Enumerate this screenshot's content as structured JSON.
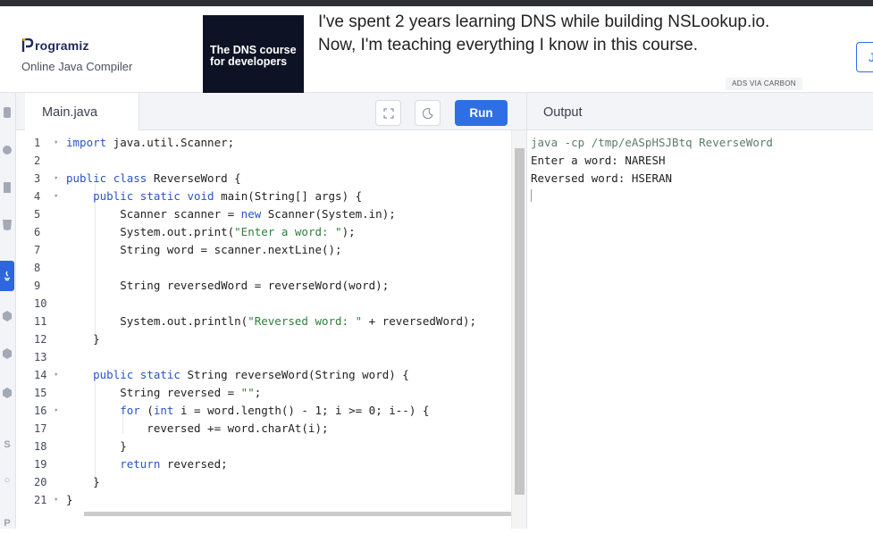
{
  "brand": {
    "name": "rogramiz",
    "logo_letter": "P",
    "subtitle": "Online Java Compiler"
  },
  "ad": {
    "box_line1": "The DNS course",
    "box_line2": "for developers",
    "text": "I've spent 2 years learning DNS while building NSLookup.io. Now, I'm teaching everything I know in this course.",
    "tag": "ADS VIA CARBON"
  },
  "header_button": {
    "label": "J"
  },
  "sidebar": {
    "icons": [
      "python-icon",
      "r-icon",
      "sql-icon",
      "html-icon",
      "java-icon",
      "c-icon",
      "cpp-icon",
      "csharp-icon",
      "js-icon",
      "go-icon",
      "php-icon"
    ],
    "active": "java-icon",
    "letters": {
      "js": "S",
      "go": "○",
      "php": "P"
    }
  },
  "editor": {
    "file_tab": "Main.java",
    "run_label": "Run",
    "fullscreen_icon": "fullscreen-icon",
    "theme_icon": "moon-icon"
  },
  "code_lines": [
    {
      "n": "1",
      "fold": true,
      "text": "import java.util.Scanner;"
    },
    {
      "n": "2",
      "fold": false,
      "text": ""
    },
    {
      "n": "3",
      "fold": true,
      "text": "public class ReverseWord {"
    },
    {
      "n": "4",
      "fold": true,
      "text": "    public static void main(String[] args) {"
    },
    {
      "n": "5",
      "fold": false,
      "text": "        Scanner scanner = new Scanner(System.in);"
    },
    {
      "n": "6",
      "fold": false,
      "text": "        System.out.print(\"Enter a word: \");"
    },
    {
      "n": "7",
      "fold": false,
      "text": "        String word = scanner.nextLine();"
    },
    {
      "n": "8",
      "fold": false,
      "text": ""
    },
    {
      "n": "9",
      "fold": false,
      "text": "        String reversedWord = reverseWord(word);"
    },
    {
      "n": "10",
      "fold": false,
      "text": ""
    },
    {
      "n": "11",
      "fold": false,
      "text": "        System.out.println(\"Reversed word: \" + reversedWord);"
    },
    {
      "n": "12",
      "fold": false,
      "text": "    }"
    },
    {
      "n": "13",
      "fold": false,
      "text": ""
    },
    {
      "n": "14",
      "fold": true,
      "text": "    public static String reverseWord(String word) {"
    },
    {
      "n": "15",
      "fold": false,
      "text": "        String reversed = \"\";"
    },
    {
      "n": "16",
      "fold": true,
      "text": "        for (int i = word.length() - 1; i >= 0; i--) {"
    },
    {
      "n": "17",
      "fold": false,
      "text": "            reversed += word.charAt(i);"
    },
    {
      "n": "18",
      "fold": false,
      "text": "        }"
    },
    {
      "n": "19",
      "fold": false,
      "text": "        return reversed;"
    },
    {
      "n": "20",
      "fold": false,
      "text": "    }"
    },
    {
      "n": "21",
      "fold": true,
      "text": "}"
    }
  ],
  "output": {
    "title": "Output",
    "lines": [
      "java -cp /tmp/eASpHSJBtq ReverseWord",
      "Enter a word: NARESH",
      "Reversed word: HSERAN"
    ]
  },
  "colors": {
    "accent": "#2f6fe6",
    "keyword": "#2b54c5",
    "string": "#2d7f3c"
  }
}
